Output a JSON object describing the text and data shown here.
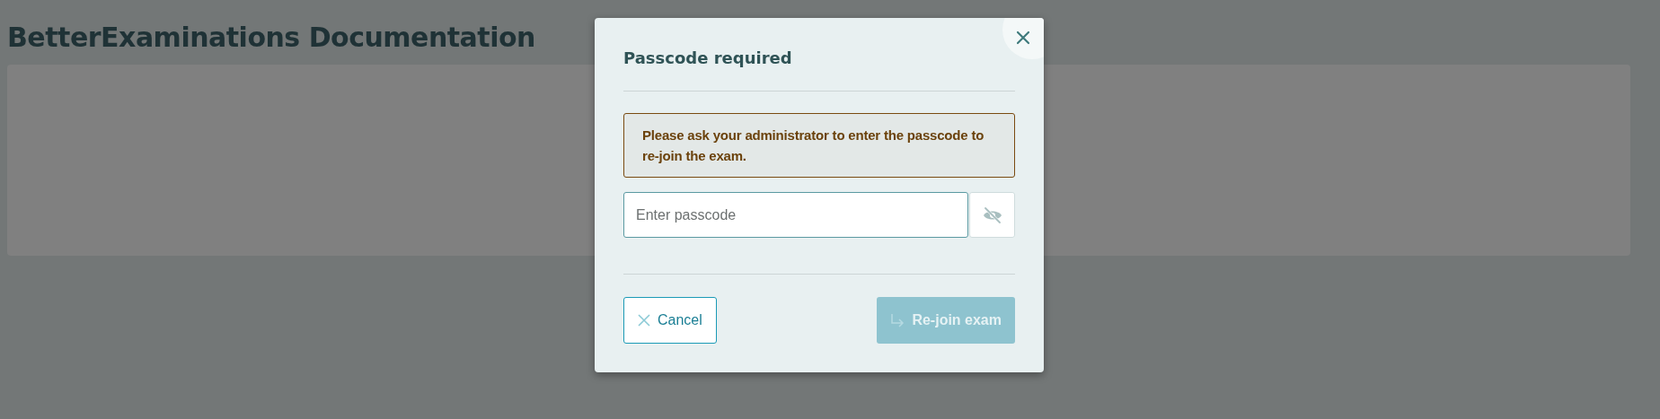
{
  "page": {
    "title": "BetterExaminations Documentation"
  },
  "dialog": {
    "title": "Passcode required",
    "alert": "Please ask your administrator to enter the passcode to re-join the exam.",
    "passcode": {
      "placeholder": "Enter passcode",
      "visible": false
    },
    "buttons": [
      {
        "kind": "cancel",
        "label": "Cancel",
        "disabled": false
      },
      {
        "kind": "rejoin",
        "label": "Re-join exam",
        "disabled": true
      }
    ]
  }
}
